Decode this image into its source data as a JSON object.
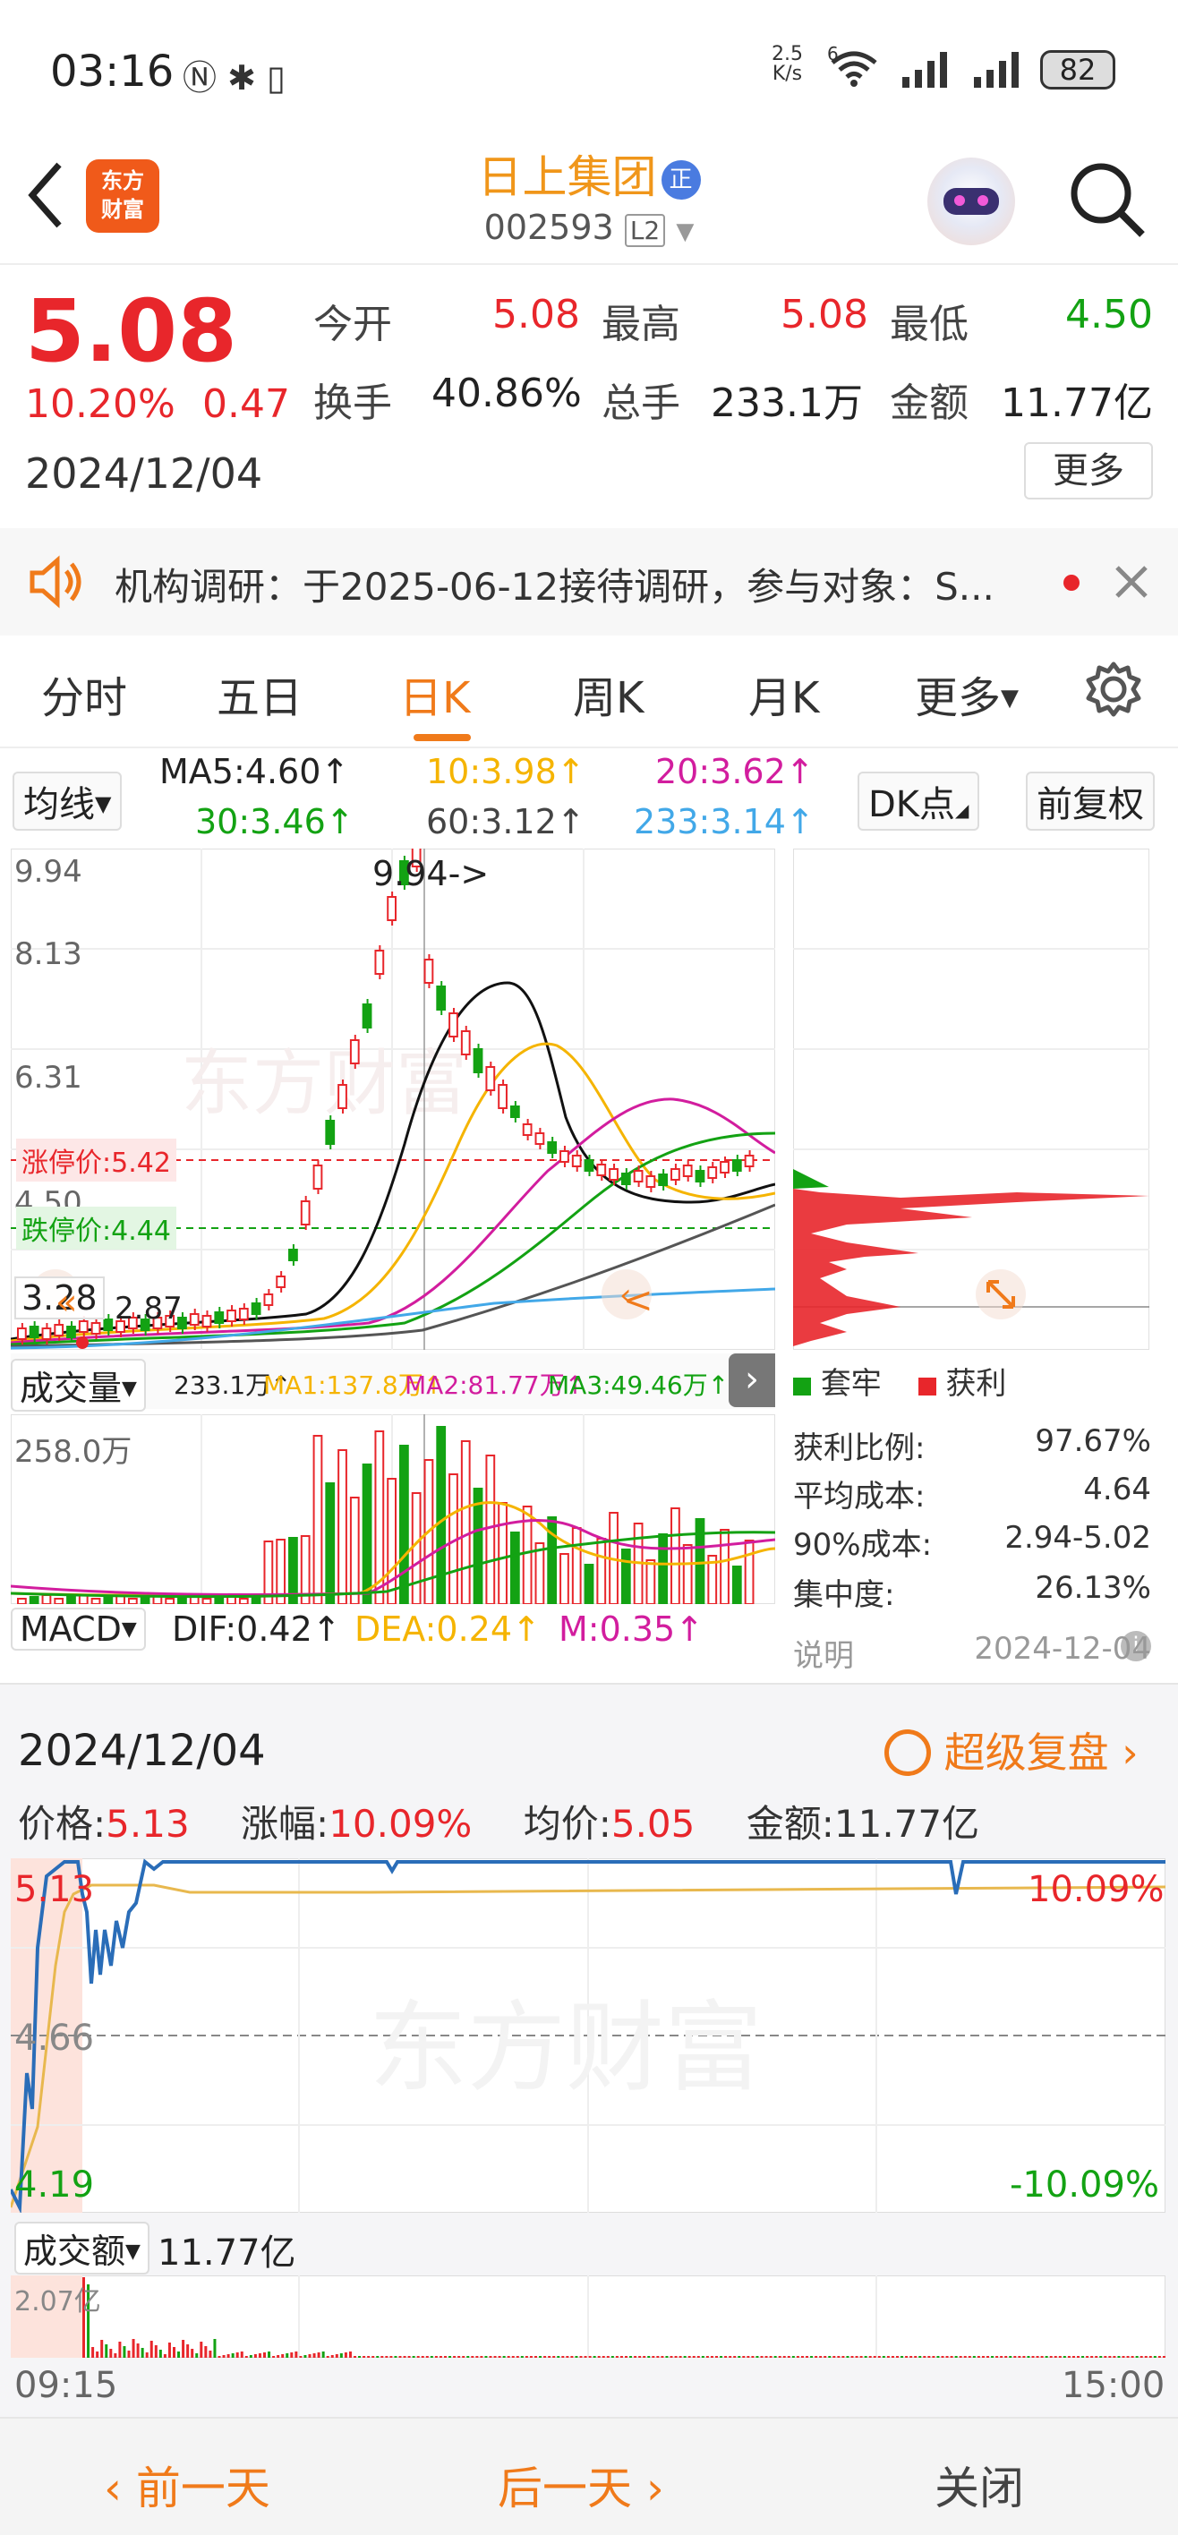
{
  "statusbar": {
    "time": "03:16",
    "net_speed_value": "2.5",
    "net_speed_unit": "K/s",
    "battery": "82",
    "signal_label": "6"
  },
  "header": {
    "logo_line1": "东方",
    "logo_line2": "财富",
    "title": "日上集团",
    "title_badge": "正",
    "code": "002593",
    "level": "L2"
  },
  "quote": {
    "price": "5.08",
    "change_pct": "10.20%",
    "change": "0.47",
    "date": "2024/12/04",
    "fields": [
      {
        "label": "今开",
        "value": "5.08",
        "color": "red"
      },
      {
        "label": "最高",
        "value": "5.08",
        "color": "red"
      },
      {
        "label": "最低",
        "value": "4.50",
        "color": "green"
      },
      {
        "label": "换手",
        "value": "40.86%",
        "color": "dark"
      },
      {
        "label": "总手",
        "value": "233.1万",
        "color": "dark"
      },
      {
        "label": "金额",
        "value": "11.77亿",
        "color": "dark"
      }
    ],
    "more_button": "更多"
  },
  "notice": {
    "text": "机构调研：于2025-06-12接待调研，参与对象：S..."
  },
  "tabs": [
    "分时",
    "五日",
    "日K",
    "周K",
    "月K",
    "更多"
  ],
  "active_tab": "日K",
  "ma_bar": {
    "selector": "均线",
    "ma5": "MA5:4.60↑",
    "ma10": "10:3.98↑",
    "ma20": "20:3.62↑",
    "ma30": "30:3.46↑",
    "ma60": "60:3.12↑",
    "ma233": "233:3.14↑",
    "dk_button": "DK点",
    "fq_button": "前复权"
  },
  "kchart": {
    "y_labels": [
      "9.94",
      "8.13",
      "6.31",
      "4.50",
      "3.28"
    ],
    "peak_label": "9.94->",
    "low_label": "2.87",
    "limit_up": "涨停价:5.42",
    "limit_down": "跌停价:4.44"
  },
  "volume": {
    "selector": "成交量",
    "value": "233.1万↑",
    "ma1": "MA1:137.8万↑",
    "ma2": "MA2:81.77万↑",
    "ma3": "MA3:49.46万↑",
    "y_label": "258.0万"
  },
  "macd": {
    "selector": "MACD",
    "dif": "DIF:0.42↑",
    "dea": "DEA:0.24↑",
    "m": "M:0.35↑"
  },
  "chips": {
    "legend_trapped": "套牢",
    "legend_profit": "获利",
    "rows": [
      {
        "label": "获利比例:",
        "value": "97.67%"
      },
      {
        "label": "平均成本:",
        "value": "4.64"
      },
      {
        "label": "90%成本:",
        "value": "2.94-5.02"
      },
      {
        "label": "集中度:",
        "value": "26.13%"
      }
    ],
    "note": "说明",
    "date": "2024-12-04"
  },
  "intraday": {
    "date": "2024/12/04",
    "replay": "超级复盘",
    "price_label": "价格:",
    "price": "5.13",
    "pct_label": "涨幅:",
    "pct": "10.09%",
    "avg_label": "均价:",
    "avg": "5.05",
    "amt_label": "金额:",
    "amt": "11.77亿",
    "y_top": "5.13",
    "y_mid": "4.66",
    "y_bot": "4.19",
    "pct_top": "10.09%",
    "pct_bot": "-10.09%",
    "turnover_selector": "成交额",
    "turnover": "11.77亿",
    "turnover_max": "2.07亿",
    "time_start": "09:15",
    "time_end": "15:00"
  },
  "bottom": {
    "prev": "前一天",
    "next": "后一天",
    "close": "关闭"
  },
  "watermark": "东方财富",
  "colors": {
    "up": "#e8262b",
    "down": "#13a213",
    "accent": "#f07a1a"
  }
}
